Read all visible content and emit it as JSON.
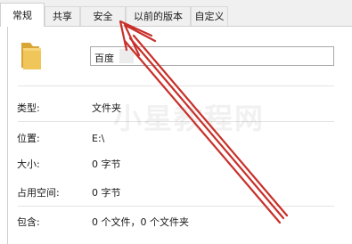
{
  "tabs": [
    {
      "label": "常规",
      "active": true
    },
    {
      "label": "共享",
      "active": false
    },
    {
      "label": "安全",
      "active": false
    },
    {
      "label": "以前的版本",
      "active": false
    },
    {
      "label": "自定义",
      "active": false
    }
  ],
  "name_field": {
    "value": "百度"
  },
  "properties": [
    {
      "label": "类型:",
      "value": "文件夹"
    },
    {
      "label": "位置:",
      "value": "E:\\"
    },
    {
      "label": "大小:",
      "value": "0 字节"
    },
    {
      "label": "占用空间:",
      "value": "0 字节"
    },
    {
      "label": "包含:",
      "value": "0 个文件，0 个文件夹"
    }
  ],
  "watermark": "小星教程网",
  "colors": {
    "arrow": "#c8302a",
    "folder": "#e8b94a",
    "tab_bg": "#f0f0f0"
  },
  "icons": {
    "folder": "folder-icon"
  }
}
